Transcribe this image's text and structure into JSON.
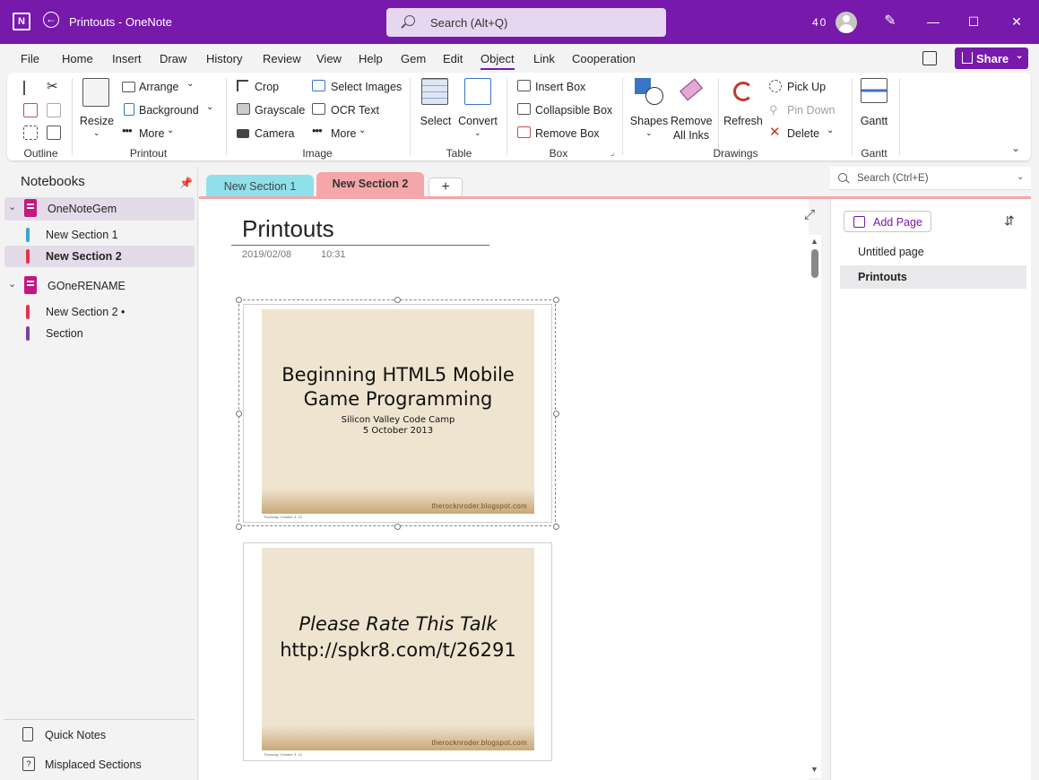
{
  "titlebar": {
    "app_icon": "onenote-icon",
    "title": "Printouts  -  OneNote",
    "search_placeholder": "Search (Alt+Q)",
    "count": "40",
    "minimize": "—",
    "maximize": "☐",
    "close": "✕"
  },
  "menu": {
    "items": [
      "File",
      "Home",
      "Insert",
      "Draw",
      "History",
      "Review",
      "View",
      "Help",
      "Gem",
      "Edit",
      "Object",
      "Link",
      "Cooperation"
    ],
    "active": "Object",
    "share": "Share"
  },
  "ribbon": {
    "groups": {
      "outline": "Outline",
      "printout": "Printout",
      "image": "Image",
      "table": "Table",
      "box": "Box",
      "drawings": "Drawings",
      "gantt": "Gantt"
    },
    "printout": {
      "resize": "Resize",
      "arrange": "Arrange",
      "background": "Background",
      "more": "More"
    },
    "image": {
      "crop": "Crop",
      "grayscale": "Grayscale",
      "camera": "Camera",
      "select_images": "Select Images",
      "ocr_text": "OCR Text",
      "more": "More"
    },
    "table": {
      "select": "Select",
      "convert": "Convert"
    },
    "box": {
      "insert_box": "Insert Box",
      "collapsible_box": "Collapsible Box",
      "remove_box": "Remove Box"
    },
    "drawings": {
      "shapes": "Shapes",
      "remove_all_inks_1": "Remove",
      "remove_all_inks_2": "All Inks",
      "refresh": "Refresh",
      "pick_up": "Pick Up",
      "pin_down": "Pin Down",
      "delete": "Delete"
    },
    "gantt": {
      "gantt": "Gantt"
    }
  },
  "leftnav": {
    "title": "Notebooks",
    "notebooks": [
      {
        "name": "OneNoteGem",
        "sections": [
          {
            "name": "New Section 1",
            "color": "#3aa3d6"
          },
          {
            "name": "New Section 2",
            "color": "#e8314b"
          }
        ]
      },
      {
        "name": "GOneRENAME",
        "sections": [
          {
            "name": "New Section 2",
            "color": "#e8314b",
            "marker": "•"
          },
          {
            "name": "Section",
            "color": "#7b3fa0"
          }
        ]
      }
    ],
    "quick_notes": "Quick Notes",
    "misplaced_sections": "Misplaced Sections"
  },
  "tabs": {
    "items": [
      {
        "label": "New Section 1",
        "color": "#8fe0ea"
      },
      {
        "label": "New Section 2",
        "color": "#f4a6a9"
      }
    ],
    "add": "+"
  },
  "page": {
    "title": "Printouts",
    "date": "2019/02/08",
    "time": "10:31",
    "slides": [
      {
        "line1": "Beginning HTML5 Mobile",
        "line2": "Game Programming",
        "sub1": "Silicon Valley Code Camp",
        "sub2": "5 October 2013",
        "footer": "therocknroder.blogspot.com",
        "date": "Thursday, October 3, 13"
      },
      {
        "line1": "Please Rate This Talk",
        "line2": "http://spkr8.com/t/26291",
        "footer": "therocknroder.blogspot.com",
        "date": "Thursday, October 3, 13"
      }
    ]
  },
  "rightpanel": {
    "search_placeholder": "Search (Ctrl+E)",
    "add_page": "Add Page",
    "pages": [
      {
        "title": "Untitled page",
        "selected": false
      },
      {
        "title": "Printouts",
        "selected": true
      }
    ]
  }
}
